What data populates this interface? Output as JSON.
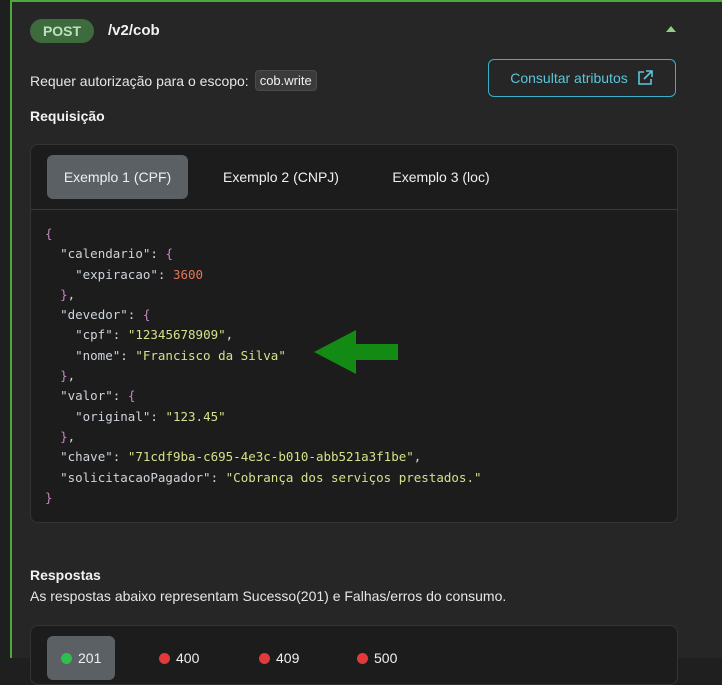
{
  "endpoint": {
    "method": "POST",
    "path": "/v2/cob"
  },
  "colors": {
    "accent": "#4fa83a",
    "link": "#5cc6dc",
    "success": "#2fbf4f",
    "error": "#e23a3a"
  },
  "scope": {
    "label": "Requer autorização para o escopo:",
    "value": "cob.write"
  },
  "attributes_button": {
    "label": "Consultar atributos",
    "icon": "external-link-icon"
  },
  "request": {
    "title": "Requisição",
    "tabs": [
      "Exemplo 1 (CPF)",
      "Exemplo 2 (CNPJ)",
      "Exemplo 3 (loc)"
    ],
    "active_tab": 0,
    "code": {
      "calendario_key": "\"calendario\"",
      "expiracao_key": "\"expiracao\"",
      "expiracao_value": "3600",
      "devedor_key": "\"devedor\"",
      "cpf_key": "\"cpf\"",
      "cpf_value": "\"12345678909\"",
      "nome_key": "\"nome\"",
      "nome_value": "\"Francisco da Silva\"",
      "valor_key": "\"valor\"",
      "original_key": "\"original\"",
      "original_value": "\"123.45\"",
      "chave_key": "\"chave\"",
      "chave_value": "\"71cdf9ba-c695-4e3c-b010-abb521a3f1be\"",
      "solicitacao_key": "\"solicitacaoPagador\"",
      "solicitacao_value": "\"Cobrança dos serviços prestados.\""
    }
  },
  "responses": {
    "title": "Respostas",
    "subtitle": "As respostas abaixo representam Sucesso(201) e Falhas/erros do consumo.",
    "status_tabs": [
      {
        "code": "201",
        "status": "success"
      },
      {
        "code": "400",
        "status": "error"
      },
      {
        "code": "409",
        "status": "error"
      },
      {
        "code": "500",
        "status": "error"
      }
    ]
  }
}
